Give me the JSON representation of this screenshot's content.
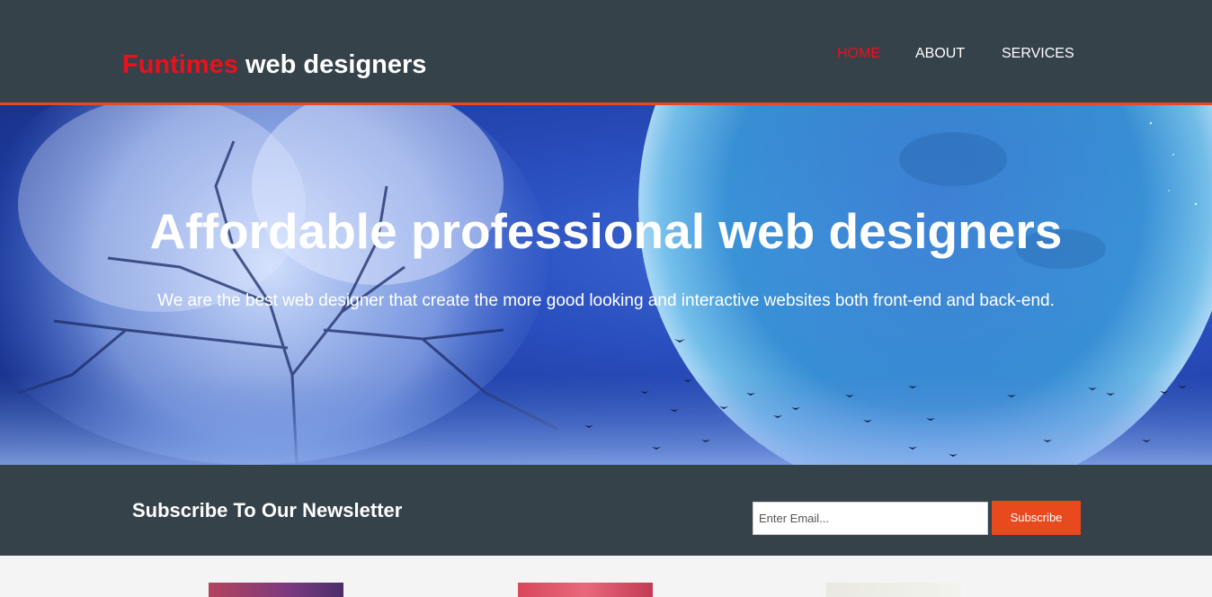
{
  "header": {
    "logo_highlight": "Funtimes",
    "logo_rest": " web designers",
    "nav": [
      {
        "label": "HOME",
        "current": true
      },
      {
        "label": "ABOUT",
        "current": false
      },
      {
        "label": "SERVICES",
        "current": false
      }
    ]
  },
  "showcase": {
    "heading": "Affordable professional web designers",
    "subheading": "We are the best web designer that create the more good looking and interactive websites both front-end and back-end."
  },
  "newsletter": {
    "title": "Subscribe To Our Newsletter",
    "email_placeholder": "Enter Email...",
    "button_label": "Subscribe"
  },
  "colors": {
    "header_bg": "#35424a",
    "accent": "#e8491d",
    "highlight": "#e8121d"
  }
}
